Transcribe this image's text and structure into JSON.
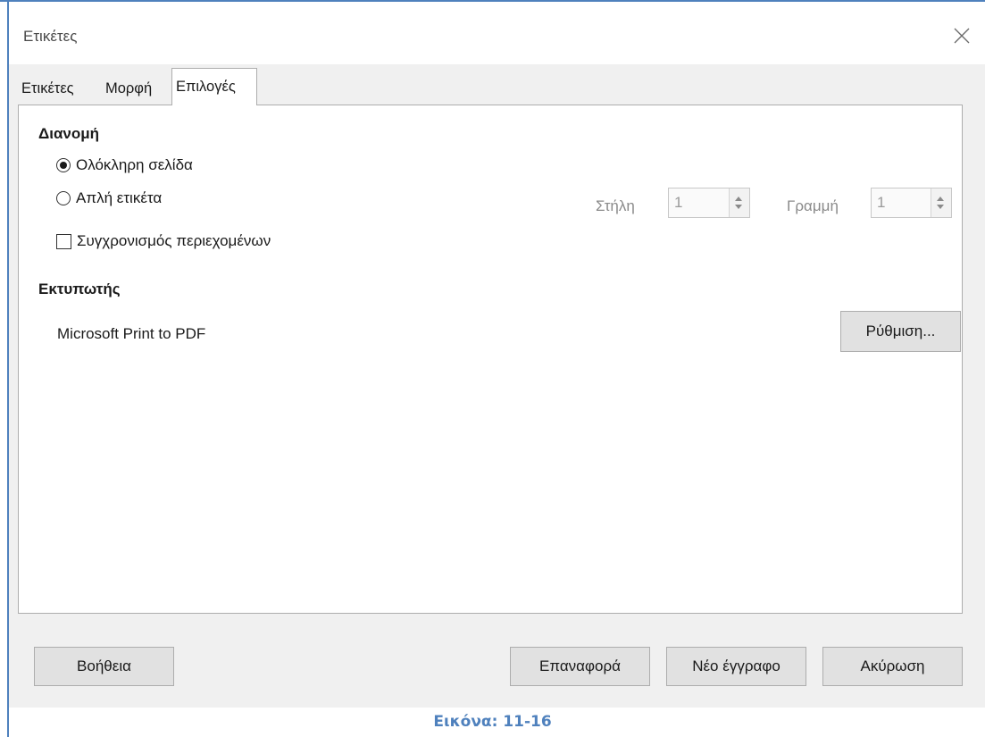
{
  "window": {
    "title": "Ετικέτες"
  },
  "tabs": [
    {
      "label": "Ετικέτες",
      "active": false
    },
    {
      "label": "Μορφή",
      "active": false
    },
    {
      "label": "Επιλογές",
      "active": true
    }
  ],
  "distribution": {
    "heading": "Διανομή",
    "options": [
      {
        "label": "Ολόκληρη σελίδα",
        "checked": true
      },
      {
        "label": "Απλή ετικέτα",
        "checked": false
      }
    ],
    "sync_label": "Συγχρονισμός περιεχομένων",
    "sync_checked": false,
    "column_label": "Στήλη",
    "column_value": "1",
    "row_label": "Γραμμή",
    "row_value": "1"
  },
  "printer": {
    "heading": "Εκτυπωτής",
    "name": "Microsoft Print to PDF",
    "setup_label": "Ρύθμιση..."
  },
  "footer": {
    "help_label": "Βοήθεια",
    "reset_label": "Επαναφορά",
    "new_doc_label": "Νέο έγγραφο",
    "cancel_label": "Ακύρωση"
  },
  "caption": "Εικόνα: 11-16",
  "colors": {
    "caption_blue": "#4f81bd",
    "dialog_bg": "#f0f0f0"
  },
  "icons": {
    "close": "close-icon"
  }
}
